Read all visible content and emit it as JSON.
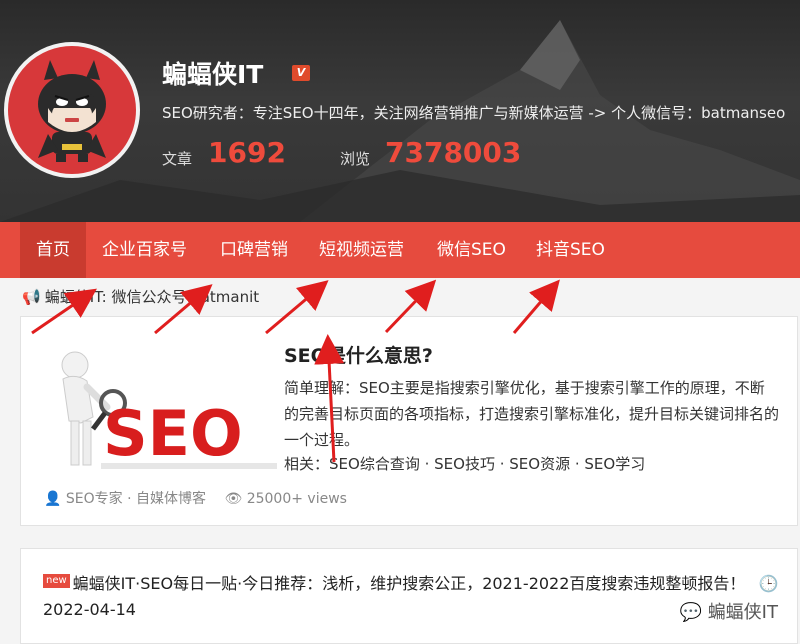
{
  "header": {
    "site_name": "蝙蝠侠IT",
    "verified_badge": "V",
    "intro": "SEO研究者：专注SEO十四年，关注网络营销推广与新媒体运营 -> 个人微信号：batmanseo",
    "articles_label": "文章",
    "articles_count": "1692",
    "views_label": "浏览",
    "views_count": "7378003"
  },
  "nav": {
    "items": [
      {
        "label": "首页",
        "active": true
      },
      {
        "label": "企业百家号"
      },
      {
        "label": "口碑营销"
      },
      {
        "label": "短视频运营"
      },
      {
        "label": "微信SEO"
      },
      {
        "label": "抖音SEO"
      }
    ]
  },
  "notice": {
    "icon": "megaphone-icon",
    "text": "蝙蝠侠IT: 微信公众号 batmanit"
  },
  "post": {
    "title": "SEO是什么意思?",
    "excerpt": "简单理解：SEO主要是指搜索引擎优化，基于搜索引擎工作的原理，不断的完善目标页面的各项指标，打造搜索引擎标准化，提升目标关键词排名的一个过程。",
    "related_label": "相关：",
    "related": [
      "SEO综合查询",
      "SEO技巧",
      "SEO资源",
      "SEO学习"
    ],
    "author": "SEO专家 · 自媒体博客",
    "views": "25000+ views",
    "thumb_text": "SEO"
  },
  "daily": {
    "badge": "new",
    "text": "蝙蝠侠IT·SEO每日一贴·今日推荐：浅析，维护搜索公正，2021-2022百度搜索违规整顿报告！",
    "date": "2022-04-14"
  },
  "watermark": "蝙蝠侠IT",
  "colors": {
    "accent": "#e64b3e",
    "nav_active": "#c93b2f",
    "stat": "#ef4b3c"
  }
}
